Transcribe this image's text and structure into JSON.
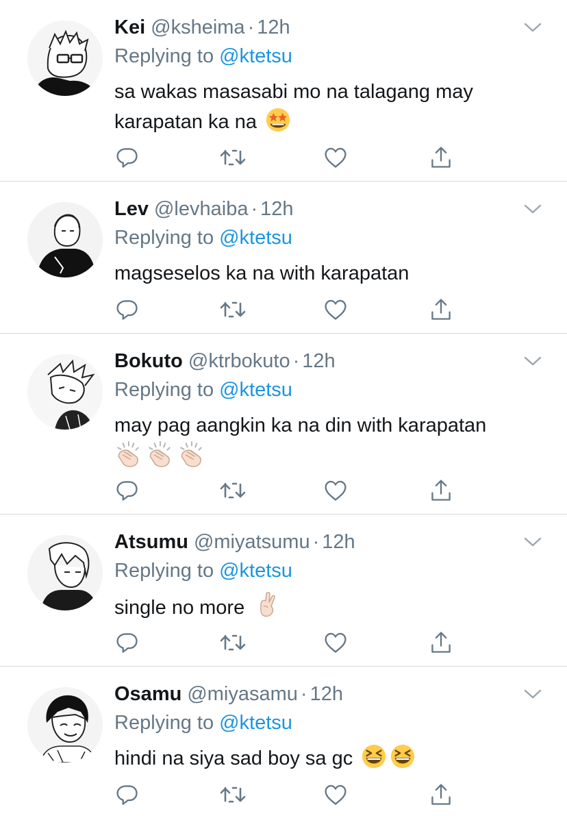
{
  "tweets": [
    {
      "name": "Kei",
      "handle": "@ksheima",
      "separator": "·",
      "time": "12h",
      "replying_label": "Replying to",
      "replying_to": "@ktetsu",
      "text": "sa wakas masasabi mo na talagang may karapatan ka na",
      "emojis": [
        "star-struck-face"
      ]
    },
    {
      "name": "Lev",
      "handle": "@levhaiba",
      "separator": "·",
      "time": "12h",
      "replying_label": "Replying to",
      "replying_to": "@ktetsu",
      "text": "magseselos ka na with karapatan",
      "emojis": []
    },
    {
      "name": "Bokuto",
      "handle": "@ktrbokuto",
      "separator": "·",
      "time": "12h",
      "replying_label": "Replying to",
      "replying_to": "@ktetsu",
      "text": "may pag aangkin ka na din with karapatan",
      "emojis": [
        "clapping-hands",
        "clapping-hands",
        "clapping-hands"
      ]
    },
    {
      "name": "Atsumu",
      "handle": "@miyatsumu",
      "separator": "·",
      "time": "12h",
      "replying_label": "Replying to",
      "replying_to": "@ktetsu",
      "text": "single no more",
      "emojis": [
        "crossed-fingers"
      ]
    },
    {
      "name": "Osamu",
      "handle": "@miyasamu",
      "separator": "·",
      "time": "12h",
      "replying_label": "Replying to",
      "replying_to": "@ktetsu",
      "text": "hindi na siya sad boy sa gc",
      "emojis": [
        "grinning-squinting-face",
        "grinning-squinting-face"
      ]
    }
  ],
  "colors": {
    "text": "#14171a",
    "secondary": "#657786",
    "link": "#1b95e0",
    "divider": "#d4d8db",
    "icon": "#657786"
  },
  "icons": [
    "reply-icon",
    "retweet-icon",
    "like-icon",
    "share-icon",
    "chevron-down-icon"
  ]
}
